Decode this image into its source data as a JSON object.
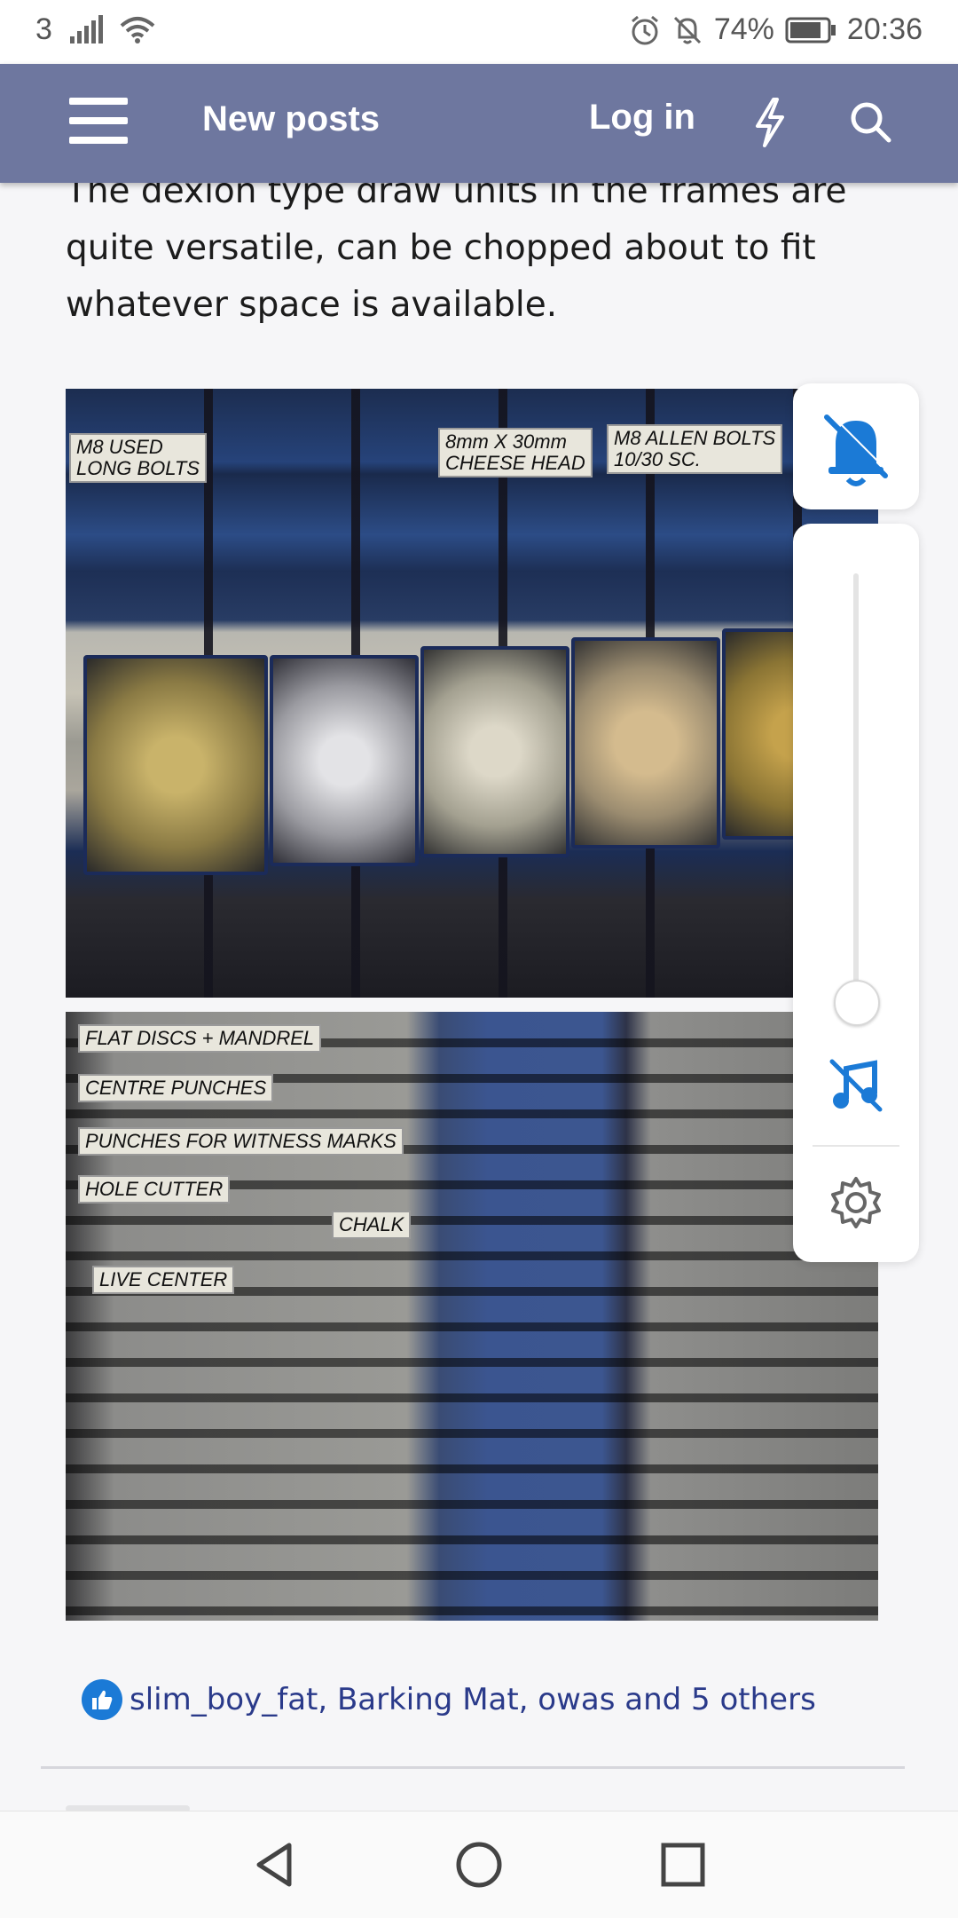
{
  "status_bar": {
    "carrier": "3",
    "battery_percent": "74%",
    "time": "20:36",
    "icons": [
      "signal-icon",
      "wifi-icon",
      "alarm-icon",
      "notifications-off-icon",
      "battery-icon"
    ]
  },
  "nav": {
    "title": "New posts",
    "login_label": "Log in",
    "icons": [
      "menu-icon",
      "bolt-icon",
      "search-icon"
    ],
    "background": "#6e779f"
  },
  "post": {
    "text_lines": [
      "The dexion type draw units in the frames are",
      "quite versatile, can be chopped about to fit",
      "whatever space is available."
    ],
    "photo1_labels": [
      "M8 USED\nLONG BOLTS",
      "8mm X 30mm\nCHEESE HEAD",
      "M8 ALLEN BOLTS\n10/30 SC."
    ],
    "photo2_labels": [
      "FLAT DISCS + MANDREL",
      "CENTRE PUNCHES",
      "PUNCHES FOR WITNESS MARKS",
      "HOLE CUTTER",
      "CHALK",
      "LIVE CENTER"
    ]
  },
  "reactions": {
    "text": "slim_boy_fat, Barking Mat, owas and 5 others",
    "icon": "like-icon"
  },
  "volume_panel": {
    "icons": [
      "bell-off-icon",
      "music-off-icon",
      "settings-icon"
    ],
    "accent": "#1b7ad6",
    "level": 0.02
  },
  "system_nav": {
    "icons": [
      "back-icon",
      "home-icon",
      "recents-icon"
    ]
  }
}
